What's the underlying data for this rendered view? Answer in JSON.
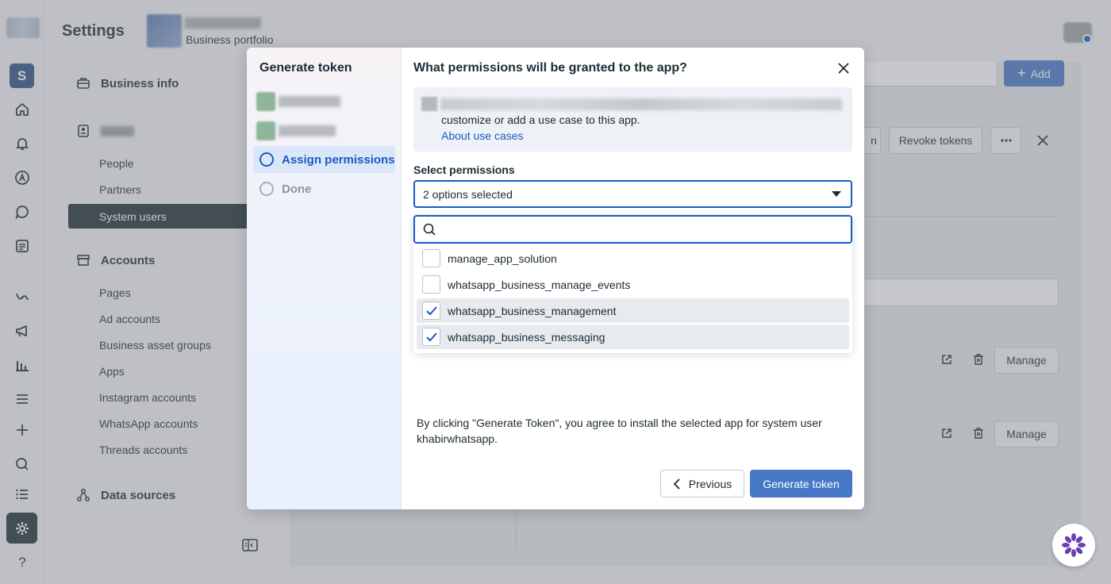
{
  "rail": {
    "workspace_letter": "S",
    "help_label": "?"
  },
  "sidebar": {
    "title": "Settings",
    "portfolio_label": "Business portfolio",
    "sections": {
      "business_info": "Business info",
      "accounts": "Accounts",
      "data_sources": "Data sources"
    },
    "users_items": [
      "People",
      "Partners",
      "System users"
    ],
    "accounts_items": [
      "Pages",
      "Ad accounts",
      "Business asset groups",
      "Apps",
      "Instagram accounts",
      "WhatsApp accounts",
      "Threads accounts"
    ]
  },
  "background": {
    "add_label": "Add",
    "revoke_label": "Revoke tokens",
    "manage_label": "Manage",
    "partial_button_label": "n"
  },
  "modal": {
    "steps_title": "Generate token",
    "steps": [
      "Assign permissions",
      "Done"
    ],
    "title": "What permissions will be granted to the app?",
    "info_text": "customize or add a use case to this app.",
    "info_link": "About use cases",
    "select_label": "Select permissions",
    "select_value": "2 options selected",
    "search_placeholder": "",
    "options": [
      {
        "label": "manage_app_solution",
        "checked": false
      },
      {
        "label": "whatsapp_business_manage_events",
        "checked": false
      },
      {
        "label": "whatsapp_business_management",
        "checked": true
      },
      {
        "label": "whatsapp_business_messaging",
        "checked": true
      }
    ],
    "agreement": "By clicking \"Generate Token\", you agree to install the selected app for system user khabirwhatsapp.",
    "previous_label": "Previous",
    "generate_label": "Generate token"
  },
  "colors": {
    "accent": "#1a5bc4",
    "primary_button": "#4678c7",
    "dark": "#1c2b33"
  }
}
